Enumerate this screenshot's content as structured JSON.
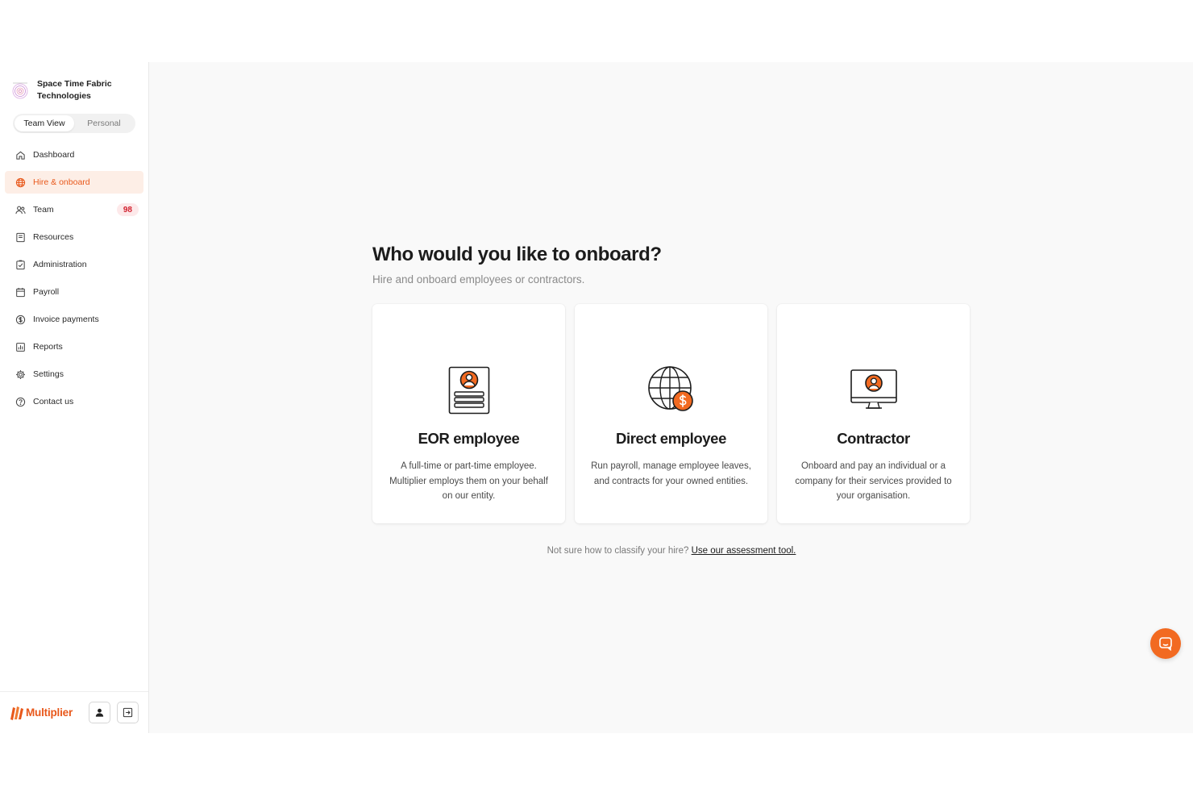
{
  "company": {
    "name": "Space Time Fabric Technologies"
  },
  "view_toggle": {
    "team": "Team View",
    "personal": "Personal",
    "selected": "Team View"
  },
  "nav": {
    "items": [
      {
        "label": "Dashboard",
        "icon": "home-icon"
      },
      {
        "label": "Hire & onboard",
        "icon": "globe-icon",
        "active": true
      },
      {
        "label": "Team",
        "icon": "users-icon",
        "badge": "98"
      },
      {
        "label": "Resources",
        "icon": "book-icon"
      },
      {
        "label": "Administration",
        "icon": "clipboard-check-icon"
      },
      {
        "label": "Payroll",
        "icon": "calendar-icon"
      },
      {
        "label": "Invoice payments",
        "icon": "dollar-circle-icon"
      },
      {
        "label": "Reports",
        "icon": "bar-chart-icon"
      },
      {
        "label": "Settings",
        "icon": "gear-icon"
      },
      {
        "label": "Contact us",
        "icon": "help-circle-icon"
      }
    ]
  },
  "footer": {
    "brand": "Multiplier"
  },
  "main": {
    "headline": "Who would you like to onboard?",
    "subline": "Hire and onboard employees or contractors.",
    "cards": [
      {
        "title": "EOR employee",
        "description": "A full-time or part-time employee. Multiplier employs them on your behalf on our entity.",
        "icon": "id-document-icon"
      },
      {
        "title": "Direct employee",
        "description": "Run payroll, manage employee leaves, and contracts for your owned entities.",
        "icon": "globe-dollar-icon"
      },
      {
        "title": "Contractor",
        "description": "Onboard and pay an individual or a company for their services provided to your organisation.",
        "icon": "monitor-user-icon"
      }
    ],
    "footnote_text": "Not sure how to classify your hire?",
    "footnote_link": "Use our assessment tool."
  },
  "colors": {
    "accent": "#e8581b",
    "badge_text": "#d11f2d",
    "fab": "#f26a21"
  }
}
